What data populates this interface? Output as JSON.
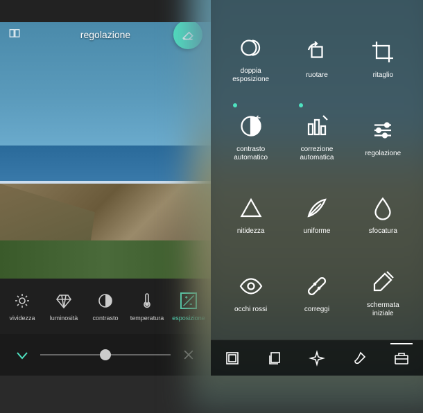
{
  "colors": {
    "accent": "#4ee2c0"
  },
  "header_title": "regolazione",
  "adjustment_tools": [
    {
      "id": "vividezza",
      "label": "vividezza",
      "icon": "sun"
    },
    {
      "id": "luminosita",
      "label": "luminosità",
      "icon": "diamond"
    },
    {
      "id": "contrasto",
      "label": "contrasto",
      "icon": "half-circle"
    },
    {
      "id": "temperatura",
      "label": "temperatura",
      "icon": "thermometer"
    },
    {
      "id": "esposizione",
      "label": "esposizione",
      "icon": "exposure",
      "active": true
    }
  ],
  "slider": {
    "value": 50,
    "min": 0,
    "max": 100
  },
  "grid_tools": [
    {
      "id": "doppia",
      "label1": "doppia",
      "label2": "esposizione",
      "icon": "double-exposure"
    },
    {
      "id": "ruotare",
      "label1": "ruotare",
      "label2": "",
      "icon": "rotate"
    },
    {
      "id": "ritaglio",
      "label1": "ritaglio",
      "label2": "",
      "icon": "crop"
    },
    {
      "id": "contrasto-auto",
      "label1": "contrasto",
      "label2": "automatico",
      "icon": "contrast-auto",
      "dot": true
    },
    {
      "id": "correzione-auto",
      "label1": "correzione",
      "label2": "automatica",
      "icon": "correction-auto",
      "dot": true
    },
    {
      "id": "regolazione",
      "label1": "regolazione",
      "label2": "",
      "icon": "sliders"
    },
    {
      "id": "nitidezza",
      "label1": "nitidezza",
      "label2": "",
      "icon": "triangle"
    },
    {
      "id": "uniforme",
      "label1": "uniforme",
      "label2": "",
      "icon": "feather"
    },
    {
      "id": "sfocatura",
      "label1": "sfocatura",
      "label2": "",
      "icon": "drop"
    },
    {
      "id": "occhi-rossi",
      "label1": "occhi rossi",
      "label2": "",
      "icon": "eye"
    },
    {
      "id": "correggi",
      "label1": "correggi",
      "label2": "",
      "icon": "bandaid"
    },
    {
      "id": "schermata",
      "label1": "schermata",
      "label2": "iniziale",
      "icon": "splash"
    }
  ],
  "bottom_nav": [
    {
      "id": "frame",
      "icon": "frame"
    },
    {
      "id": "layers",
      "icon": "layers"
    },
    {
      "id": "effects",
      "icon": "sparkle"
    },
    {
      "id": "brush",
      "icon": "brush"
    },
    {
      "id": "toolbox",
      "icon": "toolbox",
      "active": true
    }
  ]
}
